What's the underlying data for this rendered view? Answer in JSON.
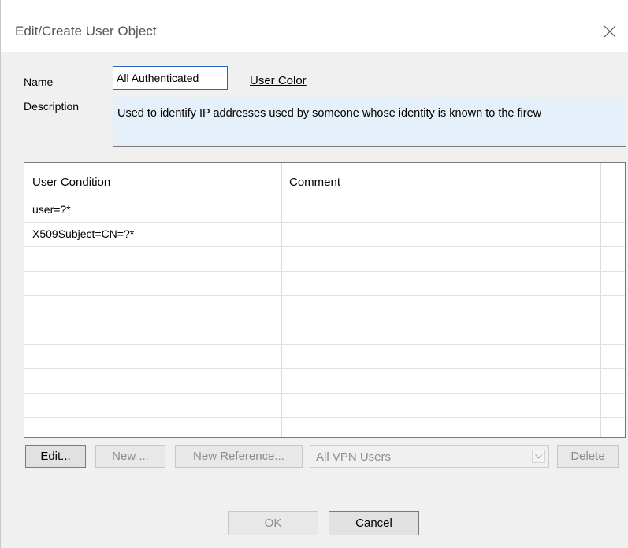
{
  "dialog": {
    "title": "Edit/Create User Object",
    "close_icon": "close-icon"
  },
  "form": {
    "name_label": "Name",
    "name_value": "All Authenticated",
    "user_color_link": "User Color",
    "description_label": "Description",
    "description_value": "Used to identify IP addresses used by someone whose identity is known to the firew"
  },
  "list": {
    "columns": [
      "User Condition",
      "Comment"
    ],
    "rows": [
      {
        "condition": "user=?*",
        "comment": ""
      },
      {
        "condition": "X509Subject=CN=?*",
        "comment": ""
      },
      {
        "condition": "",
        "comment": ""
      },
      {
        "condition": "",
        "comment": ""
      },
      {
        "condition": "",
        "comment": ""
      },
      {
        "condition": "",
        "comment": ""
      },
      {
        "condition": "",
        "comment": ""
      },
      {
        "condition": "",
        "comment": ""
      },
      {
        "condition": "",
        "comment": ""
      },
      {
        "condition": "",
        "comment": ""
      }
    ]
  },
  "actions": {
    "edit": "Edit...",
    "new": "New ...",
    "new_reference": "New Reference...",
    "combo_value": "All VPN Users",
    "delete": "Delete"
  },
  "footer": {
    "ok": "OK",
    "cancel": "Cancel"
  }
}
